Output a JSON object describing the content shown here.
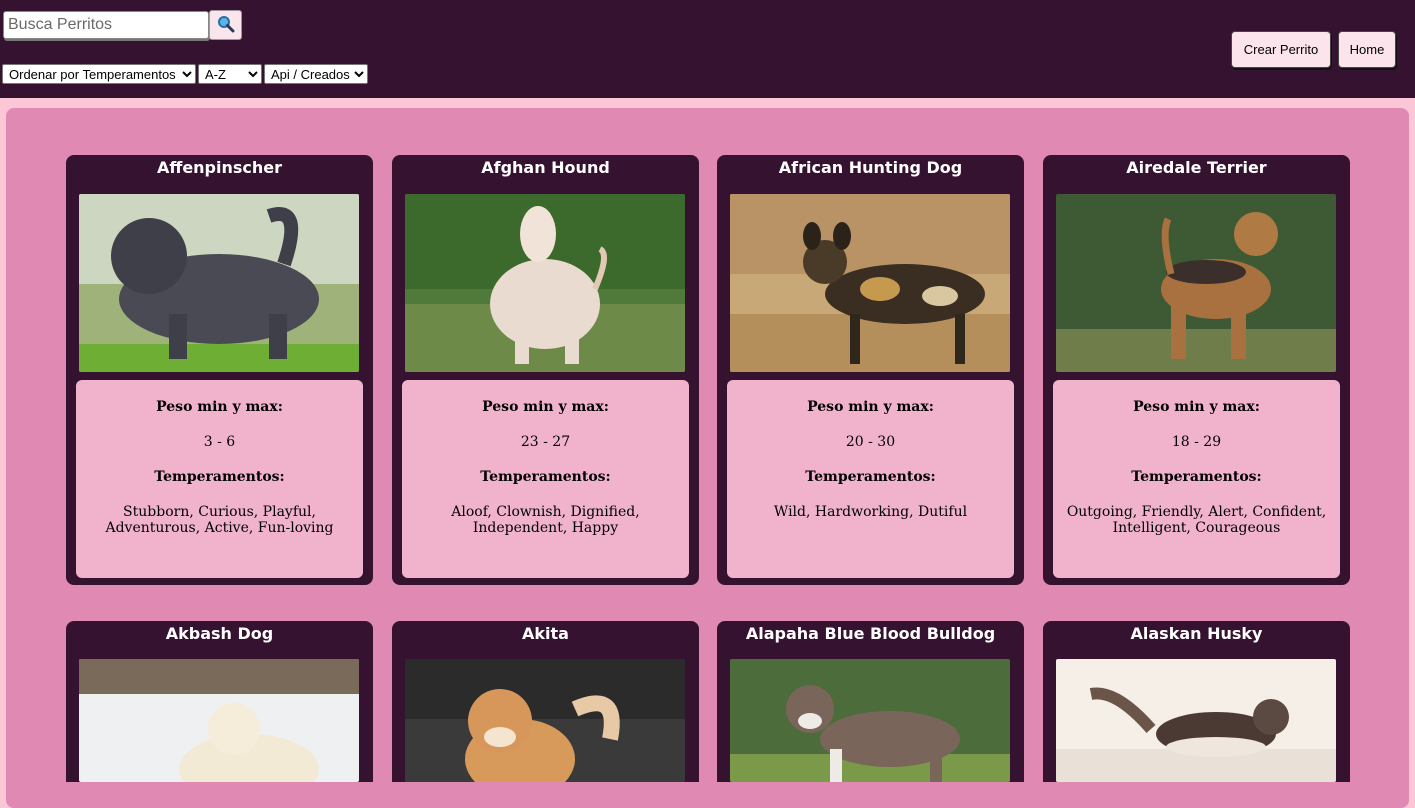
{
  "header": {
    "search_placeholder": "Busca Perritos",
    "sort_temperament": "Ordenar por Temperamentos",
    "sort_alpha": "A-Z",
    "source_filter": "Api / Creados",
    "create_button": "Crear Perrito",
    "home_button": "Home"
  },
  "card_labels": {
    "weight": "Peso min y max:",
    "temperaments": "Temperamentos:"
  },
  "dogs": [
    {
      "name": "Affenpinscher",
      "weight": "3 - 6",
      "temperament": "Stubborn, Curious, Playful, Adventurous, Active, Fun-loving"
    },
    {
      "name": "Afghan Hound",
      "weight": "23 - 27",
      "temperament": "Aloof, Clownish, Dignified, Independent, Happy"
    },
    {
      "name": "African Hunting Dog",
      "weight": "20 - 30",
      "temperament": "Wild, Hardworking, Dutiful"
    },
    {
      "name": "Airedale Terrier",
      "weight": "18 - 29",
      "temperament": "Outgoing, Friendly, Alert, Confident, Intelligent, Courageous"
    },
    {
      "name": "Akbash Dog"
    },
    {
      "name": "Akita"
    },
    {
      "name": "Alapaha Blue Blood Bulldog"
    },
    {
      "name": "Alaskan Husky"
    }
  ],
  "colors": {
    "header_bg": "#351330",
    "panel_bg": "#e089b2",
    "card_bg": "#351330",
    "card_body_bg": "#f0b3cb",
    "page_bg": "#fbc7d6"
  }
}
